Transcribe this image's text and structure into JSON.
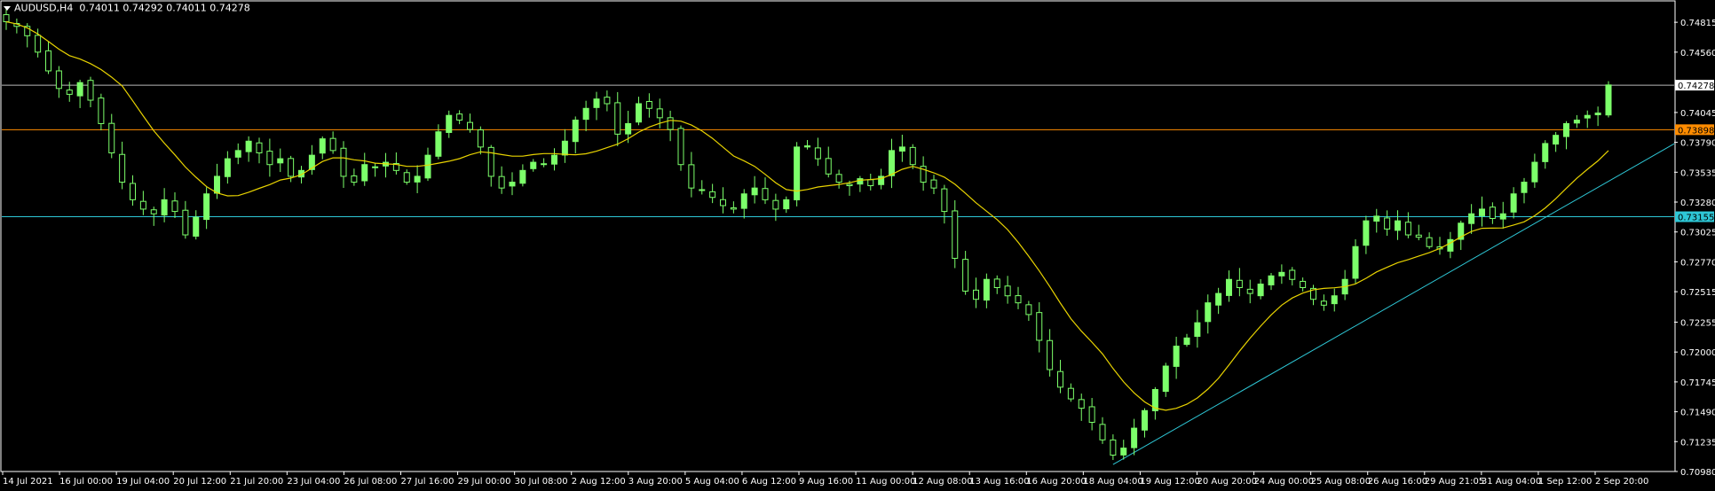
{
  "header": {
    "symbol_tf": "AUDUSD,H4",
    "ohlc": "0.74011 0.74292 0.74011 0.74278"
  },
  "colors": {
    "background": "#000000",
    "frame": "#ffffff",
    "bull_candle": "#7cff6a",
    "bear_candle": "#000000",
    "wick": "#7cff6a",
    "moving_average": "#e8d300",
    "bid_line": "#b8b8b8",
    "resistance_line": "#ff8c00",
    "support_line": "#2ec7d6",
    "trend_line": "#2ec7d6"
  },
  "price_labels": [
    "0.74815",
    "0.74560",
    "0.74045",
    "0.73790",
    "0.73535",
    "0.73280",
    "0.73025",
    "0.72770",
    "0.72515",
    "0.72255",
    "0.72000",
    "0.71745",
    "0.71490",
    "0.71235",
    "0.70980"
  ],
  "markers": {
    "bid": "0.74278",
    "resistance": "0.73898",
    "support": "0.73155"
  },
  "time_labels": [
    "14 Jul 2021",
    "16 Jul 00:00",
    "19 Jul 04:00",
    "20 Jul 12:00",
    "21 Jul 20:00",
    "23 Jul 04:00",
    "26 Jul 08:00",
    "27 Jul 16:00",
    "29 Jul 00:00",
    "30 Jul 08:00",
    "2 Aug 12:00",
    "3 Aug 20:00",
    "5 Aug 04:00",
    "6 Aug 12:00",
    "9 Aug 16:00",
    "11 Aug 00:00",
    "12 Aug 08:00",
    "13 Aug 16:00",
    "16 Aug 20:00",
    "18 Aug 04:00",
    "19 Aug 12:00",
    "20 Aug 20:00",
    "24 Aug 00:00",
    "25 Aug 08:00",
    "26 Aug 16:00",
    "29 Aug 21:05",
    "31 Aug 04:00",
    "1 Sep 12:00",
    "2 Sep 20:00"
  ],
  "chart_data": {
    "type": "candlestick",
    "symbol": "AUDUSD",
    "timeframe": "H4",
    "ylim": [
      0.7098,
      0.7499
    ],
    "close_path": [
      0.7482,
      0.7478,
      0.747,
      0.7456,
      0.744,
      0.7425,
      0.742,
      0.743,
      0.7415,
      0.7395,
      0.737,
      0.7345,
      0.733,
      0.7322,
      0.7318,
      0.733,
      0.732,
      0.73,
      0.7315,
      0.7335,
      0.735,
      0.7365,
      0.7372,
      0.738,
      0.737,
      0.736,
      0.7365,
      0.735,
      0.7355,
      0.7368,
      0.7382,
      0.7372,
      0.735,
      0.7345,
      0.736,
      0.7358,
      0.7362,
      0.7355,
      0.7345,
      0.735,
      0.7368,
      0.7388,
      0.7402,
      0.7398,
      0.739,
      0.7375,
      0.735,
      0.734,
      0.7345,
      0.7355,
      0.7362,
      0.736,
      0.7368,
      0.738,
      0.7398,
      0.7408,
      0.7416,
      0.7412,
      0.7386,
      0.7395,
      0.7412,
      0.7408,
      0.74,
      0.739,
      0.736,
      0.734,
      0.7338,
      0.7332,
      0.7325,
      0.7322,
      0.7335,
      0.734,
      0.733,
      0.7322,
      0.733,
      0.7375,
      0.7376,
      0.7365,
      0.7352,
      0.7345,
      0.7342,
      0.7348,
      0.7342,
      0.735,
      0.7372,
      0.7375,
      0.736,
      0.7345,
      0.734,
      0.732,
      0.728,
      0.7252,
      0.7245,
      0.7262,
      0.7255,
      0.7248,
      0.7242,
      0.7232,
      0.721,
      0.7185,
      0.717,
      0.716,
      0.7152,
      0.714,
      0.7125,
      0.7112,
      0.7118,
      0.7135,
      0.715,
      0.7168,
      0.7188,
      0.7205,
      0.7212,
      0.7225,
      0.7242,
      0.725,
      0.7262,
      0.7255,
      0.725,
      0.7258,
      0.7265,
      0.7268,
      0.7262,
      0.7255,
      0.7245,
      0.724,
      0.7248,
      0.7262,
      0.729,
      0.7312,
      0.7316,
      0.7305,
      0.7312,
      0.73,
      0.7298,
      0.729,
      0.7288,
      0.7296,
      0.731,
      0.7318,
      0.7322,
      0.7314,
      0.7318,
      0.7335,
      0.7345,
      0.7362,
      0.7378,
      0.7385,
      0.7395,
      0.7398,
      0.7402,
      0.7404,
      0.7428
    ]
  }
}
